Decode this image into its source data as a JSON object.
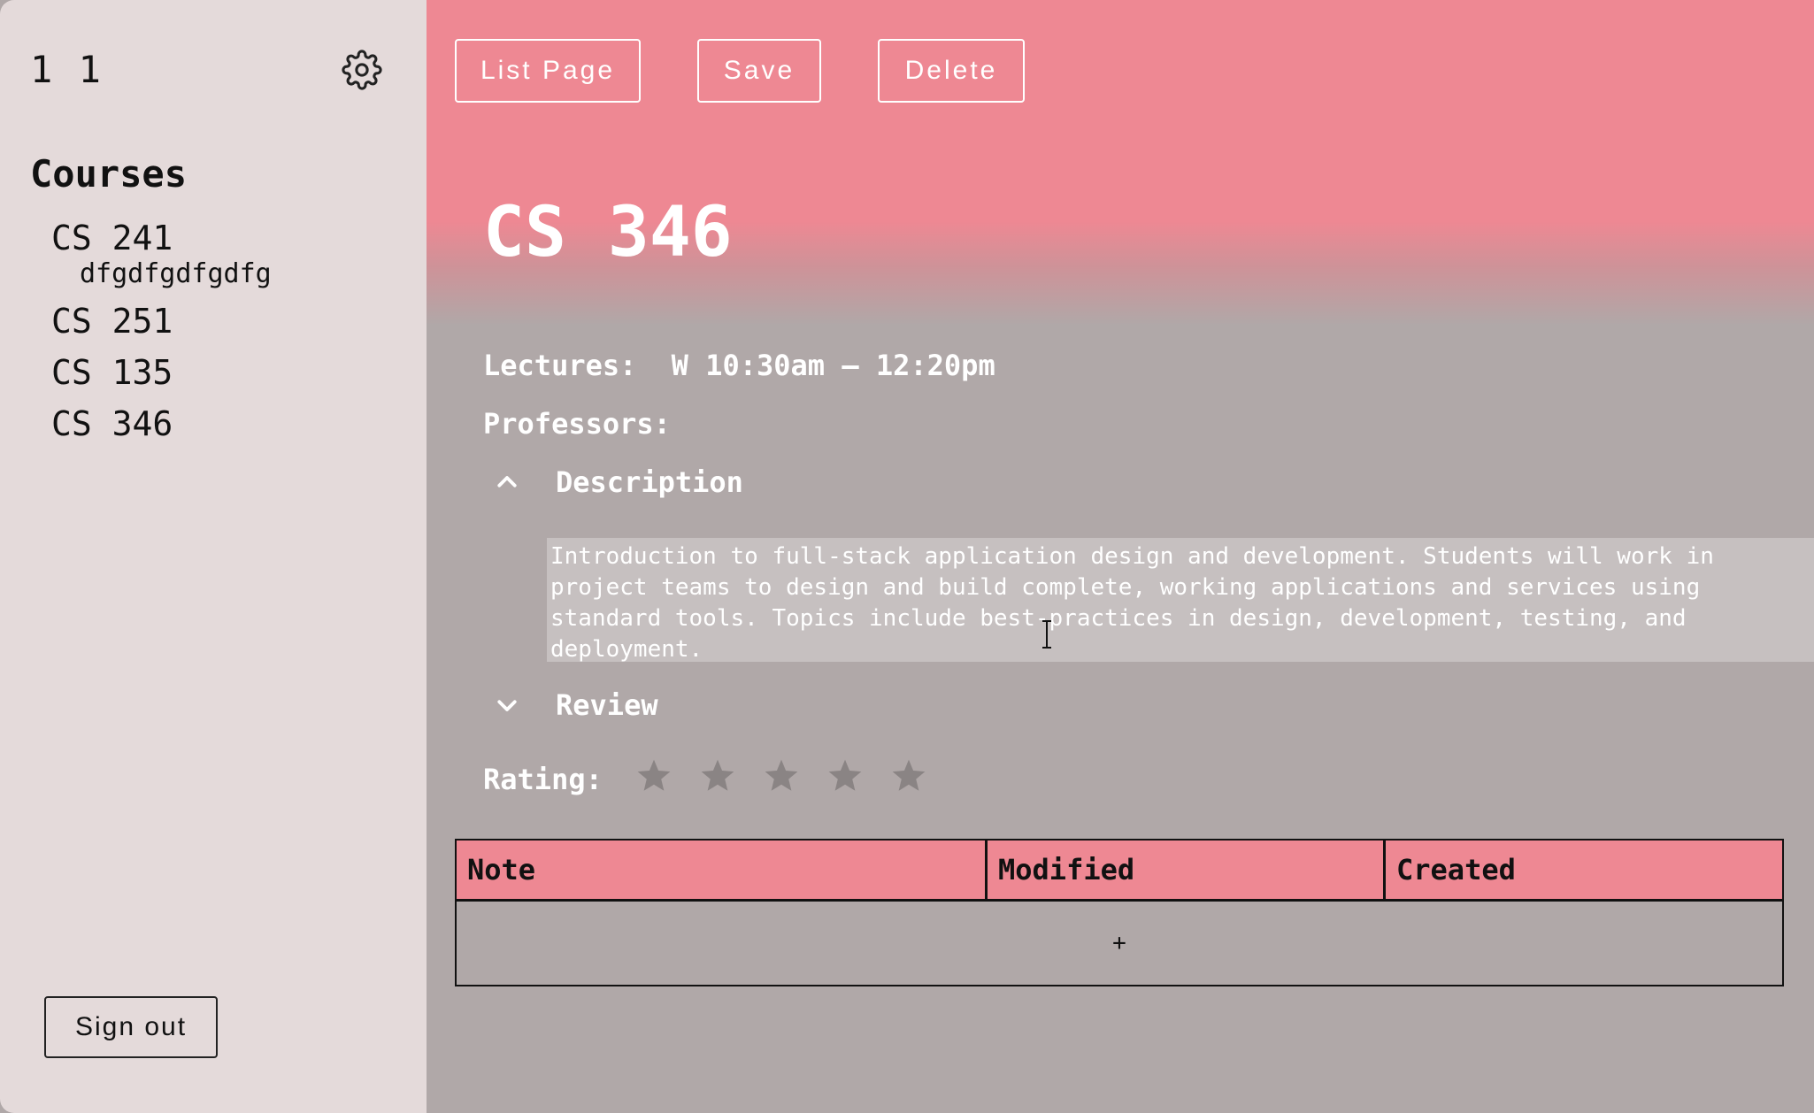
{
  "sidebar": {
    "user_name": "1 1",
    "settings_icon": "gear-icon",
    "courses_heading": "Courses",
    "courses": [
      {
        "label": "CS 241",
        "sub": "dfgdfgdfgdfg"
      },
      {
        "label": "CS 251"
      },
      {
        "label": "CS 135"
      },
      {
        "label": "CS 346"
      }
    ],
    "sign_out_label": "Sign out"
  },
  "toolbar": {
    "list_page_label": "List Page",
    "save_label": "Save",
    "delete_label": "Delete"
  },
  "course": {
    "title": "CS 346",
    "lectures_label": "Lectures:",
    "lectures_value": "W 10:30am – 12:20pm",
    "professors_label": "Professors:",
    "description_label": "Description",
    "description_text": "Introduction to full-stack application design and development. Students will work in\nproject teams to design and build complete, working applications and services using\nstandard tools. Topics include best-practices in design, development, testing, and\ndeployment.",
    "review_label": "Review",
    "rating_label": "Rating:",
    "rating_value": 0,
    "rating_max": 5
  },
  "notes_table": {
    "columns": [
      "Note",
      "Modified",
      "Created"
    ],
    "add_label": "+"
  },
  "colors": {
    "accent": "#ee8893",
    "sidebar_bg": "#e4dada",
    "main_bg": "#b0a8a8",
    "star_empty": "#8a8484"
  }
}
